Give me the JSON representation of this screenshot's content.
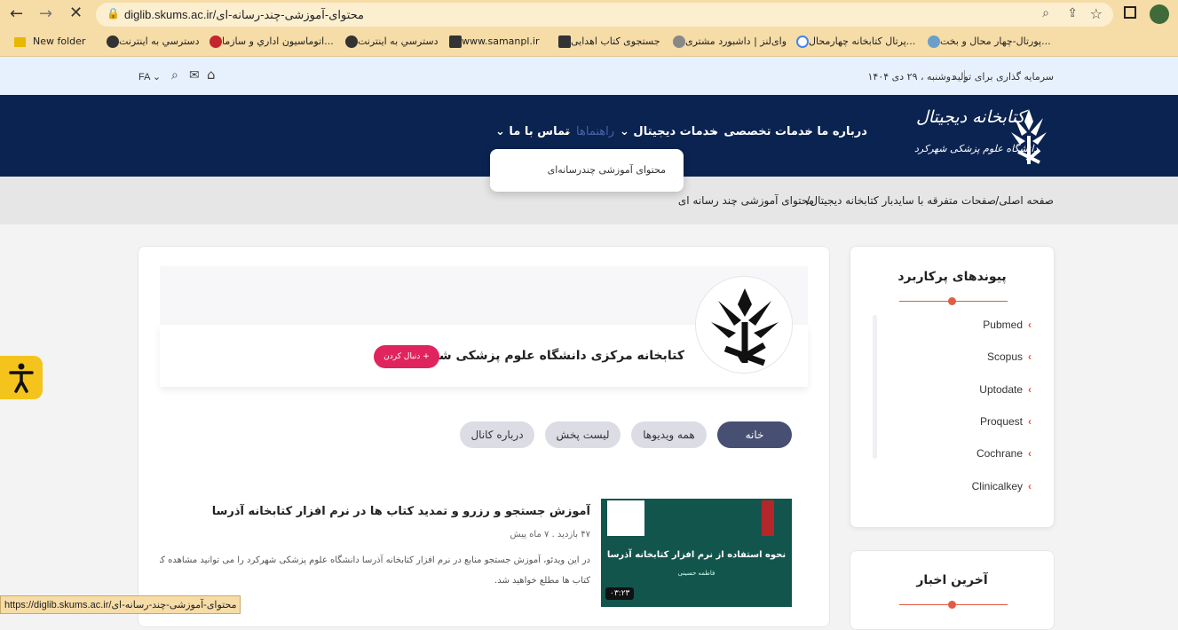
{
  "browser": {
    "url": "diglib.skums.ac.ir/محتوای-آموزشی-چند-رسانه-ای",
    "status_url": "https://diglib.skums.ac.ir/محتوای-آموزشی-چند-رسانه-ای",
    "bookmarks": [
      {
        "label": "New folder"
      },
      {
        "label": "دسترسي به اينترنت"
      },
      {
        "label": "اتوماسيون اداري و سازما..."
      },
      {
        "label": "دسترسي به اينترنت"
      },
      {
        "label": "www.samanpl.ir"
      },
      {
        "label": "جستجوی کتاب اهدایی"
      },
      {
        "label": "وای‌لنز | داشبورد مشتری"
      },
      {
        "label": "پرتال کتابخانه چهارمحال..."
      },
      {
        "label": "پورتال-چهار محال و بخت..."
      }
    ]
  },
  "site": {
    "topbar_date": "دوشنبه ، ۲۹ دی ۱۴۰۴",
    "topbar_slogan": "سرمایه گذاری برای تولید",
    "lang": "FA",
    "logo_title": "کتابخانه دیجیتال",
    "logo_sub": "دانشگاه علوم پزشکی شهرکرد",
    "nav": [
      {
        "label": "درباره ما"
      },
      {
        "label": "خدمات تخصصی"
      },
      {
        "label": "خدمات دیجیتال"
      },
      {
        "label": "راهنماها"
      },
      {
        "label": "تماس با ما"
      }
    ],
    "dropdown_item": "محتوای آموزشی چندرسانه‌ای",
    "breadcrumb": [
      "صفحه اصلی",
      "صفحات متفرقه با سایدبار کتابخانه دیجیتال",
      "محتوای آموزشی چند رسانه ای"
    ],
    "channel": {
      "name": "کتابخانه مرکزی دانشگاه علوم پزشکی شهرکرد",
      "follow": "+ دنبال کردن",
      "tabs": [
        "خانه",
        "همه ویدیوها",
        "لیست پخش",
        "درباره کانال"
      ]
    },
    "video": {
      "title": "آموزش جستجو و رزرو و تمدید کتاب ها در نرم افزار کتابخانه آذرسا",
      "meta": "۴۷ بازدید  .  ۷ ماه پیش",
      "desc1": "در این ویدئو، آموزش جستجو منابع در نرم افزار کتابخانه آذرسا دانشگاه علوم پزشکی شهرکرد را می توانید مشاهده کنید. ه",
      "desc2": "کتاب ها مطلع خواهید شد.",
      "thumb_title": "نحوه استفاده از نرم افزار کتابخانه آذرسا",
      "thumb_author": "فاطمه حسینی",
      "duration": "۰۳:۲۳"
    },
    "sidebar": {
      "title": "پیوندهای پرکاربرد",
      "links": [
        "Pubmed",
        "Scopus",
        "Uptodate",
        "Proquest",
        "Cochrane",
        "Clinicalkey"
      ],
      "news_title": "آخرین اخبار"
    }
  },
  "colors": {
    "nav": "#0b2350",
    "accent": "#e25b45",
    "follow": "#e0245e",
    "chrome": "#f6dca7"
  }
}
